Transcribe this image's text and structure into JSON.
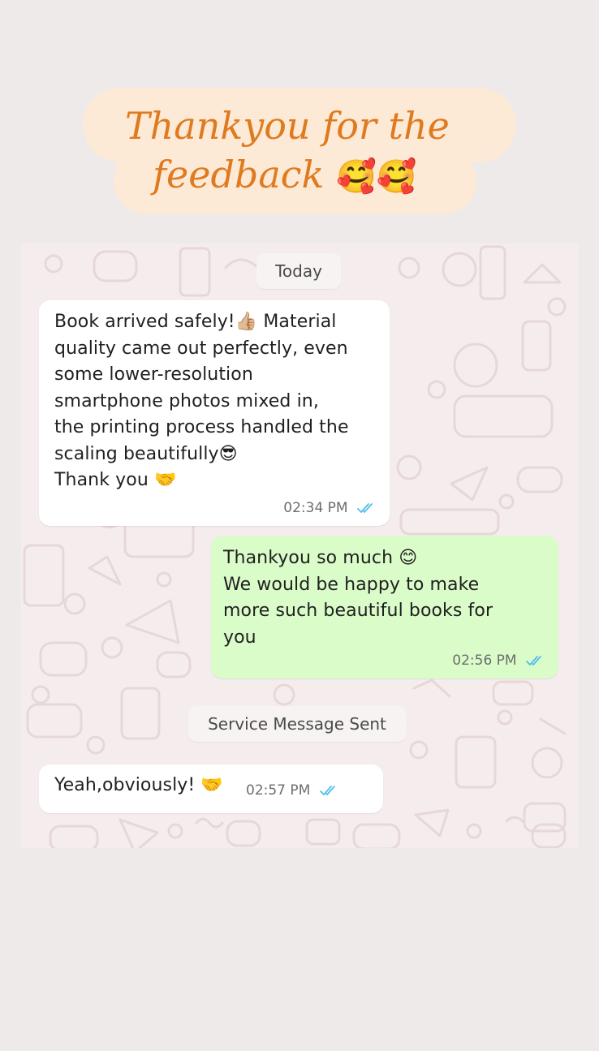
{
  "banner": {
    "line1": "Thankyou for the",
    "line2": "feedback",
    "emoji": "🥰🥰"
  },
  "chat": {
    "date_pill": "Today",
    "service_pill": "Service Message Sent",
    "messages": [
      {
        "direction": "incoming",
        "text": "Book arrived safely!👍🏼 Material\nquality came out perfectly, even\nsome lower-resolution\nsmartphone photos mixed in,\nthe printing process handled the\nscaling beautifully😎\nThank you 🤝",
        "time": "02:34 PM",
        "status": "read-double-tick-icon"
      },
      {
        "direction": "outgoing",
        "text": "Thankyou so much 😊\nWe would be happy to make\nmore such beautiful books for\nyou",
        "time": "02:56 PM",
        "status": "read-double-tick-icon"
      },
      {
        "direction": "incoming",
        "text": "Yeah,obviously! 🤝",
        "time": "02:57 PM",
        "status": "read-double-tick-icon"
      }
    ]
  },
  "colors": {
    "page_background": "#efeaea",
    "banner_pill": "#fce9d6",
    "banner_text": "#e07a1f",
    "incoming_bubble": "#ffffff",
    "outgoing_bubble": "#dafcc9",
    "tick": "#53bdeb"
  }
}
